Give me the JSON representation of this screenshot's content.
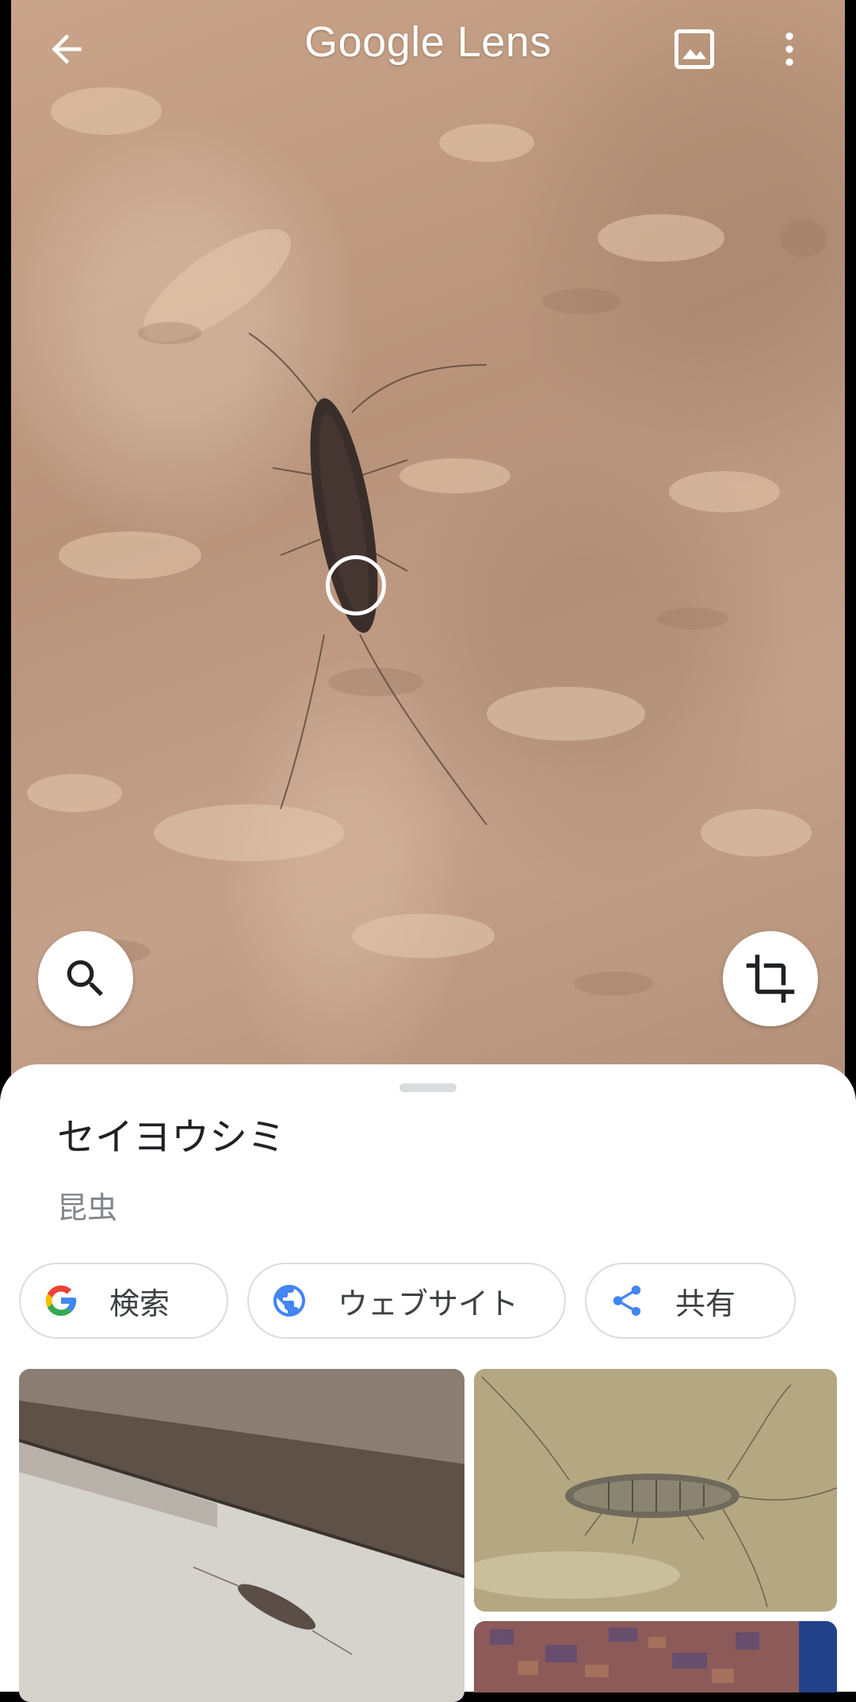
{
  "header": {
    "title": "Google Lens",
    "back_icon": "arrow-back-icon",
    "gallery_icon": "image-icon",
    "menu_icon": "more-vert-icon"
  },
  "camera": {
    "search_icon": "search-icon",
    "crop_icon": "crop-icon"
  },
  "result": {
    "title": "セイヨウシミ",
    "subtitle": "昆虫",
    "actions": [
      {
        "label": "検索",
        "icon": "google-g-icon"
      },
      {
        "label": "ウェブサイト",
        "icon": "globe-icon"
      },
      {
        "label": "共有",
        "icon": "share-icon"
      }
    ]
  },
  "colors": {
    "google_blue": "#4285f4",
    "google_red": "#ea4335",
    "google_yellow": "#fbbc05",
    "google_green": "#34a853"
  }
}
